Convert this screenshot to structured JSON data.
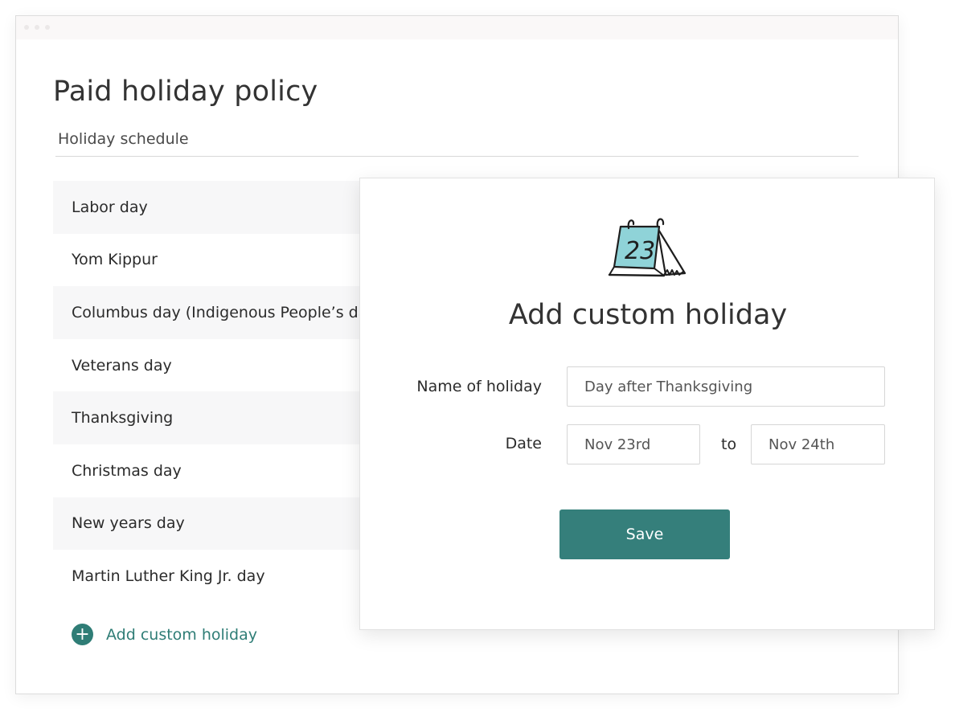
{
  "page": {
    "title": "Paid holiday policy",
    "section_label": "Holiday schedule"
  },
  "holidays": [
    {
      "label": "Labor day"
    },
    {
      "label": "Yom Kippur"
    },
    {
      "label": "Columbus day (Indigenous People’s day)"
    },
    {
      "label": "Veterans day"
    },
    {
      "label": "Thanksgiving"
    },
    {
      "label": "Christmas day"
    },
    {
      "label": "New years day"
    },
    {
      "label": "Martin Luther King Jr. day"
    }
  ],
  "add_link": {
    "icon": "plus-circle-icon",
    "label": "Add custom holiday"
  },
  "modal": {
    "icon": "calendar-icon",
    "icon_day": "23",
    "title": "Add custom holiday",
    "name_label": "Name of holiday",
    "name_value": "Day after Thanksgiving",
    "date_label": "Date",
    "date_from": "Nov 23rd",
    "to_label": "to",
    "date_to": "Nov 24th",
    "save_label": "Save"
  },
  "colors": {
    "accent": "#357f7b",
    "calendar_fill": "#8fd3d8",
    "row_shade": "#f7f7f8"
  }
}
